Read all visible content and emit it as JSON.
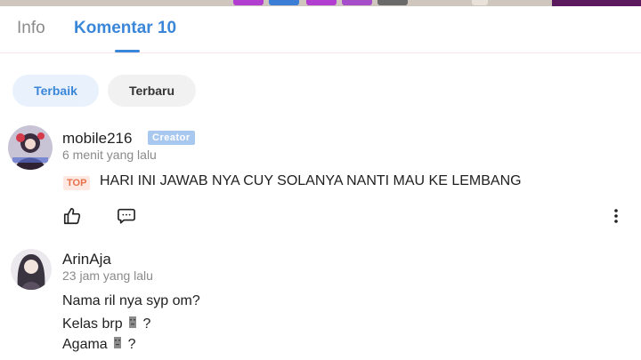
{
  "tabs": [
    {
      "label": "Info",
      "active": false
    },
    {
      "label": "Komentar 10",
      "active": true
    }
  ],
  "sort": {
    "options": [
      "Terbaik",
      "Terbaru"
    ],
    "selected": "Terbaik"
  },
  "comments": [
    {
      "username": "mobile216",
      "badge": "Creator",
      "time": "6 menit yang lalu",
      "top_label": "TOP",
      "text": "HARI INI JAWAB NYA CUY SOLANYA NANTI MAU KE LEMBANG",
      "actions": [
        "like-icon",
        "reply-icon",
        "more-icon"
      ]
    },
    {
      "username": "ArinAja",
      "time": "23 jam yang lalu",
      "lines": [
        "Nama ril nya syp om?",
        "Kelas brp",
        "?",
        "Agama",
        "?"
      ]
    }
  ],
  "colors": {
    "accent": "#3a86d8",
    "badge": "#a9c8f0",
    "top_badge": "#e8704b"
  }
}
